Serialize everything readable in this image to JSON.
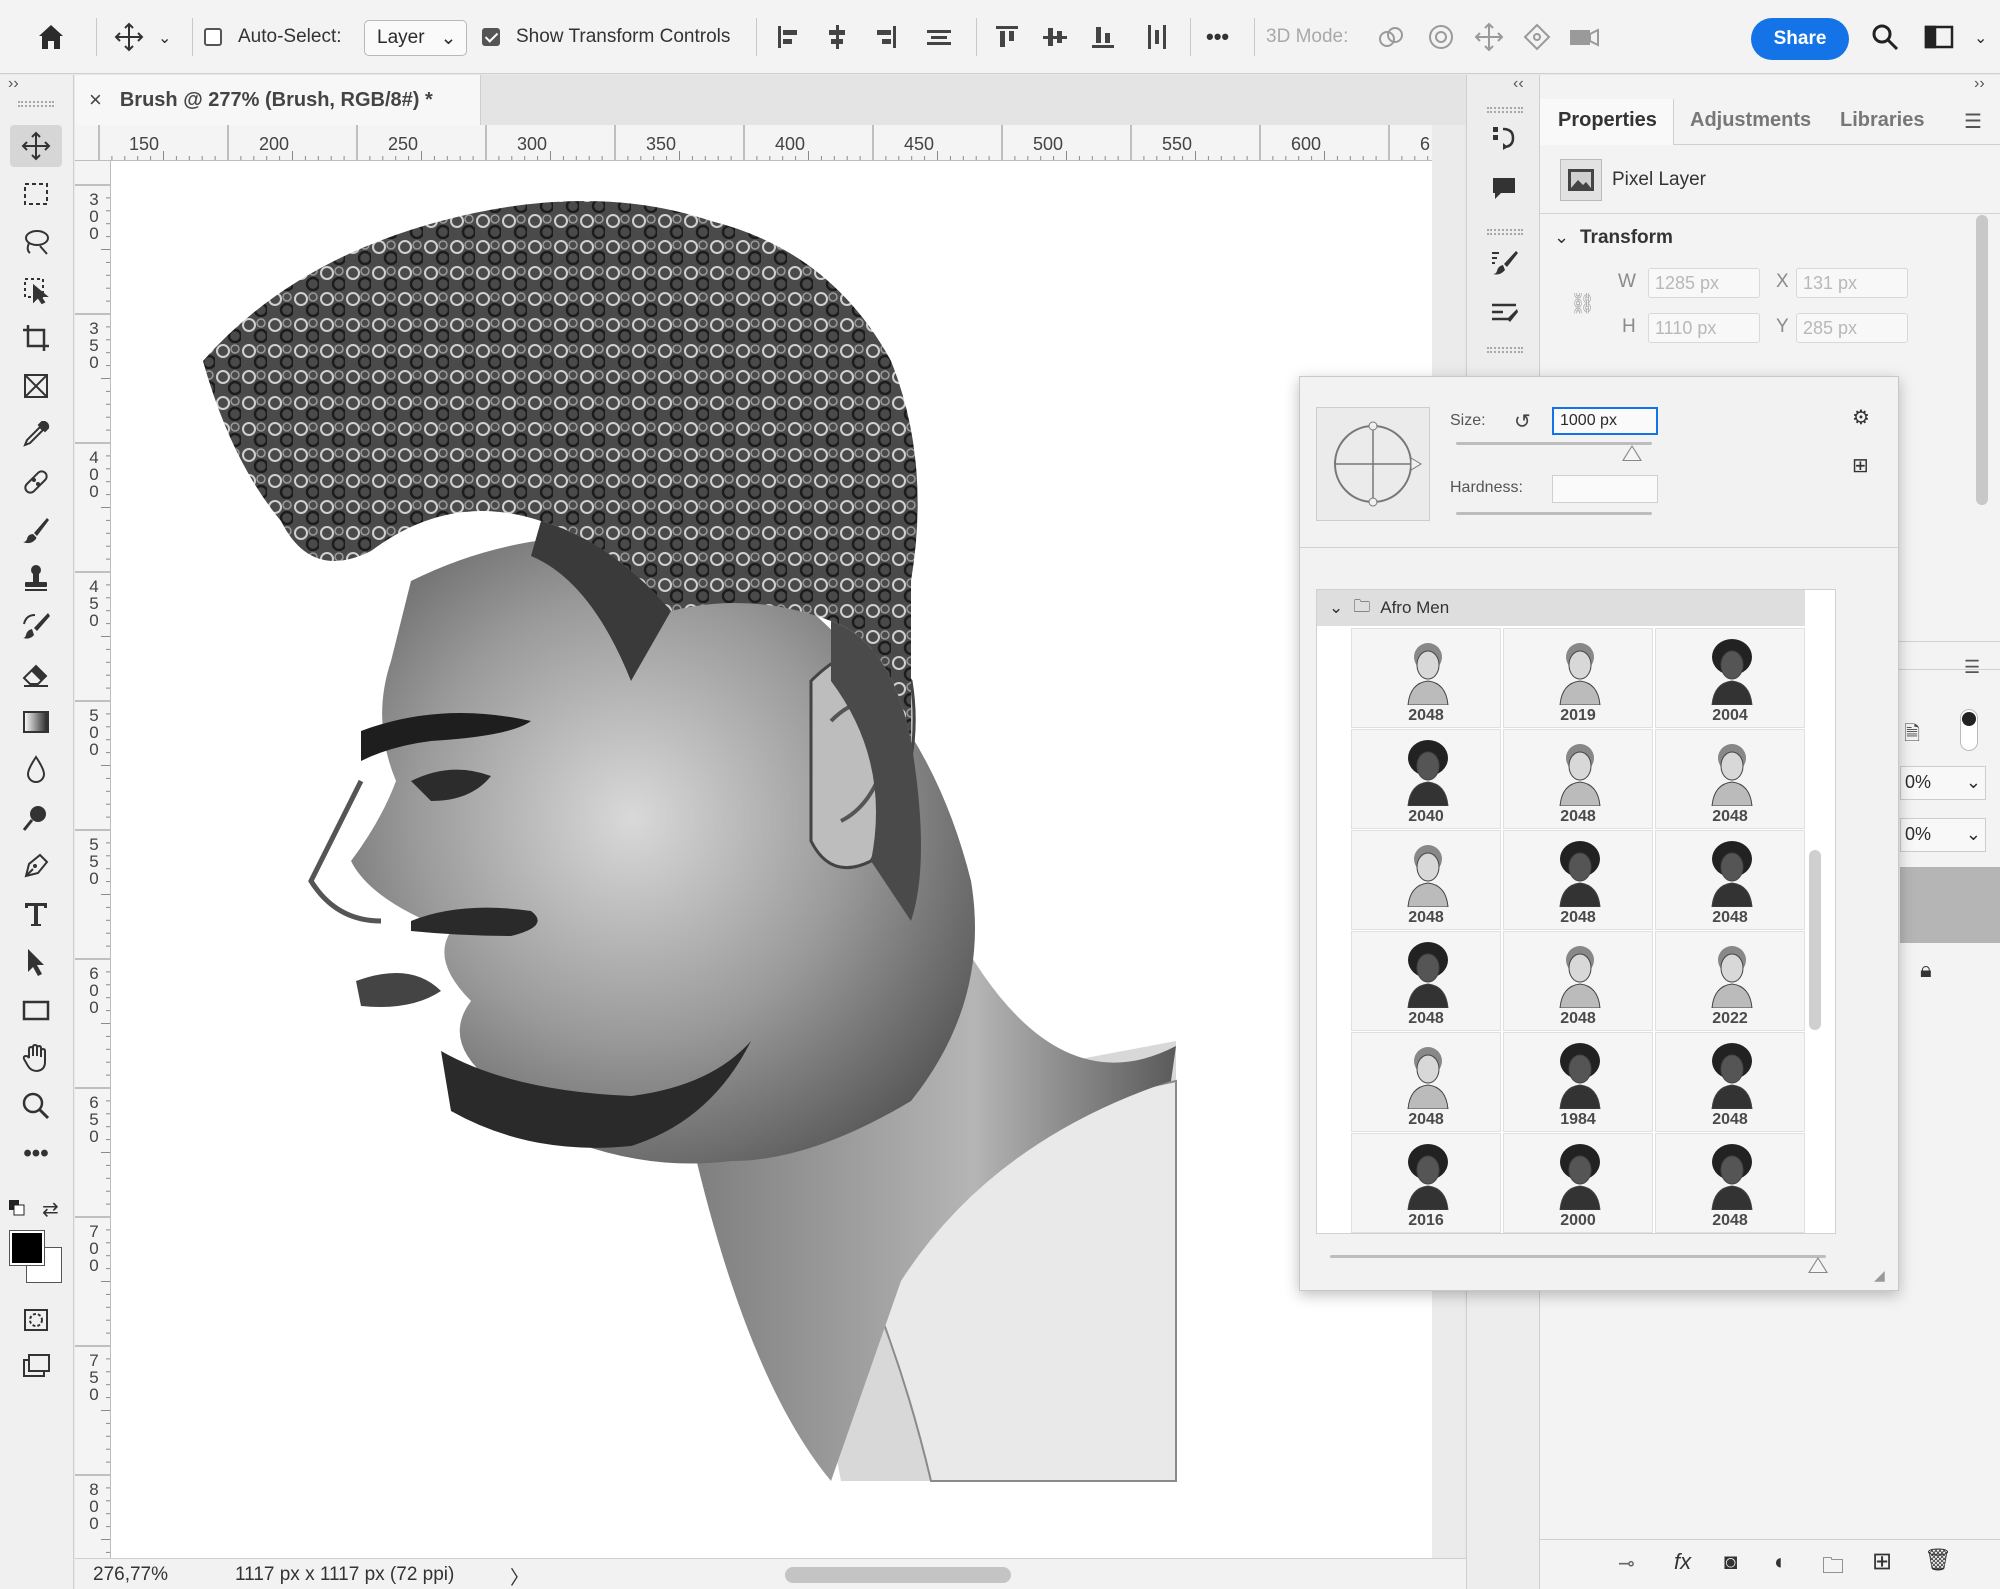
{
  "options_bar": {
    "auto_select_label": "Auto-Select:",
    "auto_select_checked": false,
    "layer_dropdown": "Layer",
    "show_transform_label": "Show Transform Controls",
    "show_transform_checked": true,
    "mode_3d_label": "3D Mode:",
    "share_label": "Share",
    "more_glyph": "•••"
  },
  "document": {
    "tab_title": "Brush @ 277% (Brush, RGB/8#) *",
    "close_glyph": "×",
    "ruler_h": [
      "150",
      "200",
      "250",
      "300",
      "350",
      "400",
      "450",
      "500",
      "550",
      "600",
      "6"
    ],
    "ruler_v": [
      "300",
      "350",
      "400",
      "450",
      "500",
      "550",
      "600",
      "650",
      "700",
      "750",
      "800"
    ],
    "zoom": "276,77%",
    "doc_info": "1117 px x 1117 px (72 ppi)",
    "status_arrow": "〉"
  },
  "properties": {
    "tabs": [
      "Properties",
      "Adjustments",
      "Libraries"
    ],
    "layer_type": "Pixel Layer",
    "section_transform": "Transform",
    "w_label": "W",
    "w_value": "1285 px",
    "x_label": "X",
    "x_value": "131 px",
    "h_label": "H",
    "h_value": "1110 px",
    "y_label": "Y",
    "y_value": "285 px",
    "opacity_partial_1": "0%",
    "opacity_partial_2": "0%"
  },
  "brush_popup": {
    "size_label": "Size:",
    "size_value": "1000 px",
    "hardness_label": "Hardness:",
    "hardness_value": "",
    "folder_name": "Afro Men",
    "brushes": [
      "2048",
      "2019",
      "2004",
      "2040",
      "2048",
      "2048",
      "2048",
      "2048",
      "2048",
      "2048",
      "2048",
      "2022",
      "2048",
      "1984",
      "2048",
      "2016",
      "2000",
      "2048"
    ]
  },
  "colors": {
    "accent": "#1473e6",
    "foreground": "#000000",
    "background": "#ffffff"
  }
}
